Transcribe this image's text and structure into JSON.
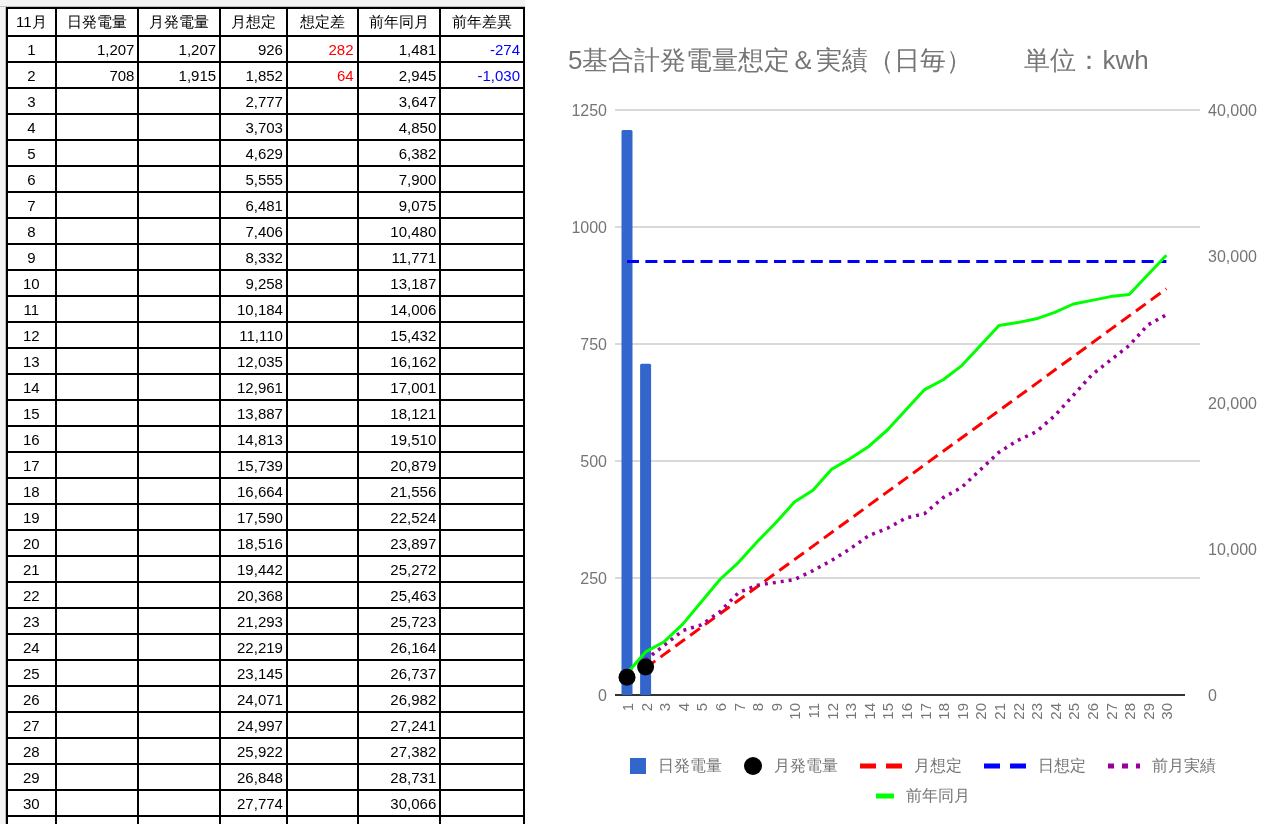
{
  "table": {
    "columns": [
      "11月",
      "日発電量",
      "月発電量",
      "月想定",
      "想定差",
      "前年同月",
      "前年差異"
    ],
    "rows": [
      {
        "cells": [
          {
            "text": "1"
          },
          {
            "text": "1,207"
          },
          {
            "text": "1,207"
          },
          {
            "text": "926"
          },
          {
            "text": "282",
            "color": "#ff0000"
          },
          {
            "text": "1,481"
          },
          {
            "text": "-274",
            "color": "#0000ff"
          }
        ]
      },
      {
        "cells": [
          {
            "text": "2"
          },
          {
            "text": "708"
          },
          {
            "text": "1,915"
          },
          {
            "text": "1,852"
          },
          {
            "text": "64",
            "color": "#ff0000"
          },
          {
            "text": "2,945"
          },
          {
            "text": "-1,030",
            "color": "#0000ff"
          }
        ]
      },
      {
        "cells": [
          {
            "text": "3"
          },
          null,
          null,
          {
            "text": "2,777"
          },
          null,
          {
            "text": "3,647"
          },
          null
        ]
      },
      {
        "cells": [
          {
            "text": "4"
          },
          null,
          null,
          {
            "text": "3,703"
          },
          null,
          {
            "text": "4,850"
          },
          null
        ]
      },
      {
        "cells": [
          {
            "text": "5"
          },
          null,
          null,
          {
            "text": "4,629"
          },
          null,
          {
            "text": "6,382"
          },
          null
        ]
      },
      {
        "cells": [
          {
            "text": "6"
          },
          null,
          null,
          {
            "text": "5,555"
          },
          null,
          {
            "text": "7,900"
          },
          null
        ]
      },
      {
        "cells": [
          {
            "text": "7"
          },
          null,
          null,
          {
            "text": "6,481"
          },
          null,
          {
            "text": "9,075"
          },
          null
        ]
      },
      {
        "cells": [
          {
            "text": "8"
          },
          null,
          null,
          {
            "text": "7,406"
          },
          null,
          {
            "text": "10,480"
          },
          null
        ]
      },
      {
        "cells": [
          {
            "text": "9"
          },
          null,
          null,
          {
            "text": "8,332"
          },
          null,
          {
            "text": "11,771"
          },
          null
        ]
      },
      {
        "cells": [
          {
            "text": "10"
          },
          null,
          null,
          {
            "text": "9,258"
          },
          null,
          {
            "text": "13,187"
          },
          null
        ]
      },
      {
        "cells": [
          {
            "text": "11"
          },
          null,
          null,
          {
            "text": "10,184"
          },
          null,
          {
            "text": "14,006"
          },
          null
        ]
      },
      {
        "cells": [
          {
            "text": "12"
          },
          null,
          null,
          {
            "text": "11,110"
          },
          null,
          {
            "text": "15,432"
          },
          null
        ]
      },
      {
        "cells": [
          {
            "text": "13"
          },
          null,
          null,
          {
            "text": "12,035"
          },
          null,
          {
            "text": "16,162"
          },
          null
        ]
      },
      {
        "cells": [
          {
            "text": "14"
          },
          null,
          null,
          {
            "text": "12,961"
          },
          null,
          {
            "text": "17,001"
          },
          null
        ]
      },
      {
        "cells": [
          {
            "text": "15"
          },
          null,
          null,
          {
            "text": "13,887"
          },
          null,
          {
            "text": "18,121"
          },
          null
        ]
      },
      {
        "cells": [
          {
            "text": "16"
          },
          null,
          null,
          {
            "text": "14,813"
          },
          null,
          {
            "text": "19,510"
          },
          null
        ]
      },
      {
        "cells": [
          {
            "text": "17"
          },
          null,
          null,
          {
            "text": "15,739"
          },
          null,
          {
            "text": "20,879"
          },
          null
        ]
      },
      {
        "cells": [
          {
            "text": "18"
          },
          null,
          null,
          {
            "text": "16,664"
          },
          null,
          {
            "text": "21,556"
          },
          null
        ]
      },
      {
        "cells": [
          {
            "text": "19"
          },
          null,
          null,
          {
            "text": "17,590"
          },
          null,
          {
            "text": "22,524"
          },
          null
        ]
      },
      {
        "cells": [
          {
            "text": "20"
          },
          null,
          null,
          {
            "text": "18,516"
          },
          null,
          {
            "text": "23,897"
          },
          null
        ]
      },
      {
        "cells": [
          {
            "text": "21"
          },
          null,
          null,
          {
            "text": "19,442"
          },
          null,
          {
            "text": "25,272"
          },
          null
        ]
      },
      {
        "cells": [
          {
            "text": "22"
          },
          null,
          null,
          {
            "text": "20,368"
          },
          null,
          {
            "text": "25,463"
          },
          null
        ]
      },
      {
        "cells": [
          {
            "text": "23"
          },
          null,
          null,
          {
            "text": "21,293"
          },
          null,
          {
            "text": "25,723"
          },
          null
        ]
      },
      {
        "cells": [
          {
            "text": "24"
          },
          null,
          null,
          {
            "text": "22,219"
          },
          null,
          {
            "text": "26,164"
          },
          null
        ]
      },
      {
        "cells": [
          {
            "text": "25"
          },
          null,
          null,
          {
            "text": "23,145"
          },
          null,
          {
            "text": "26,737"
          },
          null
        ]
      },
      {
        "cells": [
          {
            "text": "26"
          },
          null,
          null,
          {
            "text": "24,071"
          },
          null,
          {
            "text": "26,982"
          },
          null
        ]
      },
      {
        "cells": [
          {
            "text": "27"
          },
          null,
          null,
          {
            "text": "24,997"
          },
          null,
          {
            "text": "27,241"
          },
          null
        ]
      },
      {
        "cells": [
          {
            "text": "28"
          },
          null,
          null,
          {
            "text": "25,922"
          },
          null,
          {
            "text": "27,382"
          },
          null
        ]
      },
      {
        "cells": [
          {
            "text": "29"
          },
          null,
          null,
          {
            "text": "26,848"
          },
          null,
          {
            "text": "28,731"
          },
          null
        ]
      },
      {
        "cells": [
          {
            "text": "30"
          },
          null,
          null,
          {
            "text": "27,774"
          },
          null,
          {
            "text": "30,066"
          },
          null
        ]
      }
    ]
  },
  "chart": {
    "chart_data": {
      "type": "bar",
      "title": "5基合計発電量想定＆実績（日毎）　　単位：kwh",
      "categories": [
        "1",
        "2",
        "3",
        "4",
        "5",
        "6",
        "7",
        "8",
        "9",
        "10",
        "11",
        "12",
        "13",
        "14",
        "15",
        "16",
        "17",
        "18",
        "19",
        "20",
        "21",
        "22",
        "23",
        "24",
        "25",
        "26",
        "27",
        "28",
        "29",
        "30"
      ],
      "grid": true,
      "legend": "bottom",
      "ylim": [
        0,
        1250
      ],
      "yticks": [
        0,
        250,
        500,
        750,
        1000,
        1250
      ],
      "y2lim": [
        0,
        40000
      ],
      "y2ticks": [
        {
          "value": 0,
          "label": "0"
        },
        {
          "value": 10000,
          "label": "10,000"
        },
        {
          "value": 20000,
          "label": "20,000"
        },
        {
          "value": 30000,
          "label": "30,000"
        },
        {
          "value": 40000,
          "label": "40,000"
        }
      ],
      "series": [
        {
          "name": "日発電量",
          "color": "#3366cc",
          "values": [
            1207,
            708,
            null,
            null,
            null,
            null,
            null,
            null,
            null,
            null,
            null,
            null,
            null,
            null,
            null,
            null,
            null,
            null,
            null,
            null,
            null,
            null,
            null,
            null,
            null,
            null,
            null,
            null,
            null,
            null
          ]
        },
        {
          "name": "月発電量",
          "type": "scatter",
          "axis": "y2",
          "color": "#000000",
          "values": [
            1207,
            1915,
            null,
            null,
            null,
            null,
            null,
            null,
            null,
            null,
            null,
            null,
            null,
            null,
            null,
            null,
            null,
            null,
            null,
            null,
            null,
            null,
            null,
            null,
            null,
            null,
            null,
            null,
            null,
            null
          ]
        },
        {
          "name": "月想定",
          "type": "line",
          "line_style": "dashed",
          "axis": "y2",
          "color": "#ff0000",
          "values": [
            null,
            1852,
            2777,
            3703,
            4629,
            5555,
            6481,
            7406,
            8332,
            9258,
            10184,
            11110,
            12035,
            12961,
            13887,
            14813,
            15739,
            16664,
            17590,
            18516,
            19442,
            20368,
            21293,
            22219,
            23145,
            24071,
            24997,
            25922,
            26848,
            27774
          ]
        },
        {
          "name": "日想定",
          "type": "line",
          "line_style": "dashed",
          "color": "#0000ff",
          "values": [
            926,
            926,
            926,
            926,
            926,
            926,
            926,
            926,
            926,
            926,
            926,
            926,
            926,
            926,
            926,
            926,
            926,
            926,
            926,
            926,
            926,
            926,
            926,
            926,
            926,
            926,
            926,
            926,
            926,
            926
          ]
        },
        {
          "name": "前月実績",
          "type": "line",
          "line_style": "dotted",
          "axis": "y2",
          "color": "#990099",
          "values": [
            null,
            2400,
            3400,
            4400,
            4800,
            5700,
            7000,
            7500,
            7700,
            7900,
            8500,
            9200,
            10000,
            10900,
            11400,
            12100,
            12400,
            13500,
            14200,
            15400,
            16600,
            17400,
            18000,
            19100,
            20500,
            21900,
            22900,
            23900,
            25300,
            26000
          ]
        },
        {
          "name": "前年同月",
          "type": "line",
          "axis": "y2",
          "color": "#00ff00",
          "values": [
            1481,
            2945,
            3647,
            4850,
            6382,
            7900,
            9075,
            10480,
            11771,
            13187,
            14006,
            15432,
            16162,
            17001,
            18121,
            19510,
            20879,
            21556,
            22524,
            23897,
            25272,
            25463,
            25723,
            26164,
            26737,
            26982,
            27241,
            27382,
            28731,
            30066
          ]
        }
      ]
    }
  }
}
